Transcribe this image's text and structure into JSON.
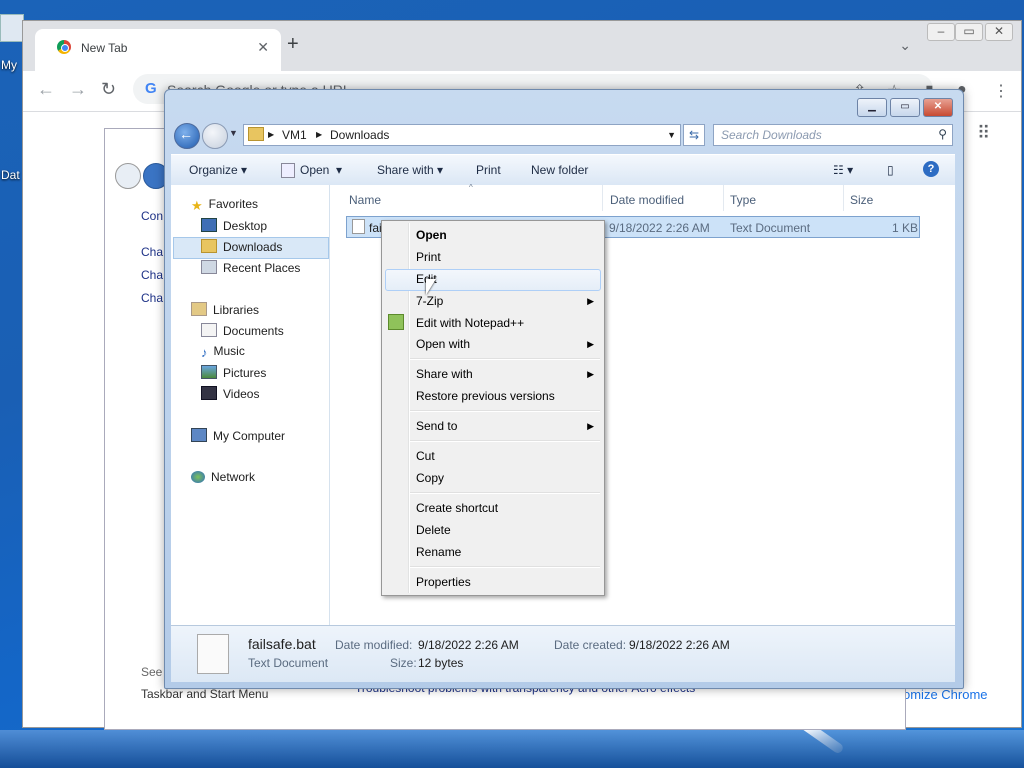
{
  "desktop": {
    "my_label": "My",
    "dat_label": "Dat"
  },
  "chrome": {
    "tab_title": "New Tab",
    "omnibox_placeholder": "Search Google or type a URL",
    "customize_label": "omize Chrome"
  },
  "control_panel": {
    "lines": [
      "Con",
      "Cha",
      "Cha",
      "Cha"
    ],
    "see": "See",
    "taskbar_link": "Taskbar and Start Menu",
    "troubleshoot": "Troubleshoot problems with transparency and other Aero effects"
  },
  "explorer": {
    "breadcrumb": [
      "VM1",
      "Downloads"
    ],
    "search_placeholder": "Search Downloads",
    "toolbar": {
      "organize": "Organize",
      "open": "Open",
      "share_with": "Share with",
      "print": "Print",
      "new_folder": "New folder"
    },
    "nav": {
      "favorites": "Favorites",
      "desktop": "Desktop",
      "downloads": "Downloads",
      "recent_places": "Recent Places",
      "libraries": "Libraries",
      "documents": "Documents",
      "music": "Music",
      "pictures": "Pictures",
      "videos": "Videos",
      "my_computer": "My Computer",
      "network": "Network"
    },
    "columns": {
      "name": "Name",
      "date_modified": "Date modified",
      "type": "Type",
      "size": "Size"
    },
    "file_row": {
      "name_visible": "fai",
      "date": "9/18/2022 2:26 AM",
      "type": "Text Document",
      "size": "1 KB"
    },
    "details": {
      "filename": "failsafe.bat",
      "filetype": "Text Document",
      "date_modified_label": "Date modified:",
      "date_modified": "9/18/2022 2:26 AM",
      "date_created_label": "Date created:",
      "date_created": "9/18/2022 2:26 AM",
      "size_label": "Size:",
      "size": "12 bytes"
    }
  },
  "context_menu": {
    "open": "Open",
    "print": "Print",
    "edit": "Edit",
    "seven_zip": "7-Zip",
    "edit_notepad": "Edit with Notepad++",
    "open_with": "Open with",
    "share_with": "Share with",
    "restore": "Restore previous versions",
    "send_to": "Send to",
    "cut": "Cut",
    "copy": "Copy",
    "create_shortcut": "Create shortcut",
    "delete": "Delete",
    "rename": "Rename",
    "properties": "Properties"
  }
}
